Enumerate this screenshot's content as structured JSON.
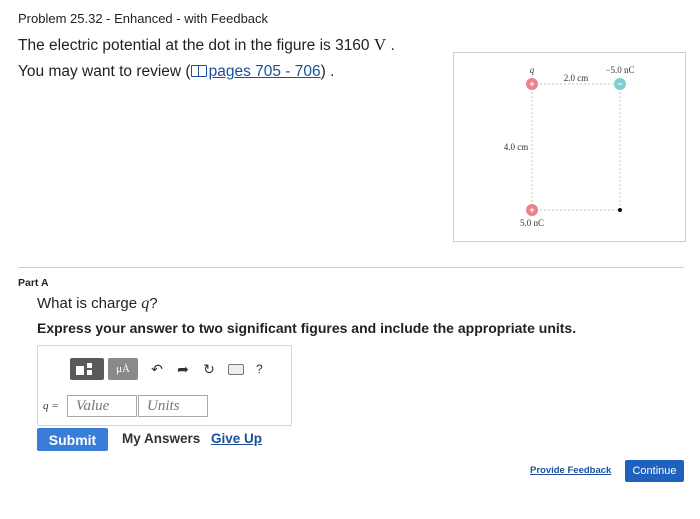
{
  "problem": {
    "header": "Problem 25.32 - Enhanced - with Feedback",
    "statement_prefix": "The electric potential at the dot in the figure is 3160",
    "statement_unit": "V",
    "statement_suffix": ".",
    "review_prefix": "You may want to review (",
    "review_link": "pages 705 - 706",
    "review_suffix": ") ."
  },
  "figure": {
    "charge_top_left": "q",
    "charge_top_right": "−5.0 nC",
    "charge_bottom_left": "5.0 nC",
    "horizontal_distance": "2.0 cm",
    "vertical_distance": "4.0 cm",
    "positive_symbol": "+",
    "negative_symbol": "−",
    "colors": {
      "positive": "#e8848a",
      "negative": "#7fcfd0",
      "dashed": "#c8c8a0"
    }
  },
  "part": {
    "label": "Part A",
    "question_prefix": "What is charge",
    "question_var": "q",
    "question_suffix": "?",
    "instruction": "Express your answer to two significant figures and include the appropriate units."
  },
  "toolbar": {
    "mu_label": "μȦ",
    "undo_icon": "undo-icon",
    "redo_icon": "redo-icon",
    "reset_icon": "reset-icon",
    "keyboard_icon": "keyboard-icon",
    "help_label": "?"
  },
  "answer": {
    "var_label": "q =",
    "value_placeholder": "Value",
    "units_placeholder": "Units"
  },
  "actions": {
    "submit": "Submit",
    "my_answers": "My Answers",
    "give_up": "Give Up",
    "provide_feedback": "Provide Feedback",
    "continue": "Continue"
  }
}
